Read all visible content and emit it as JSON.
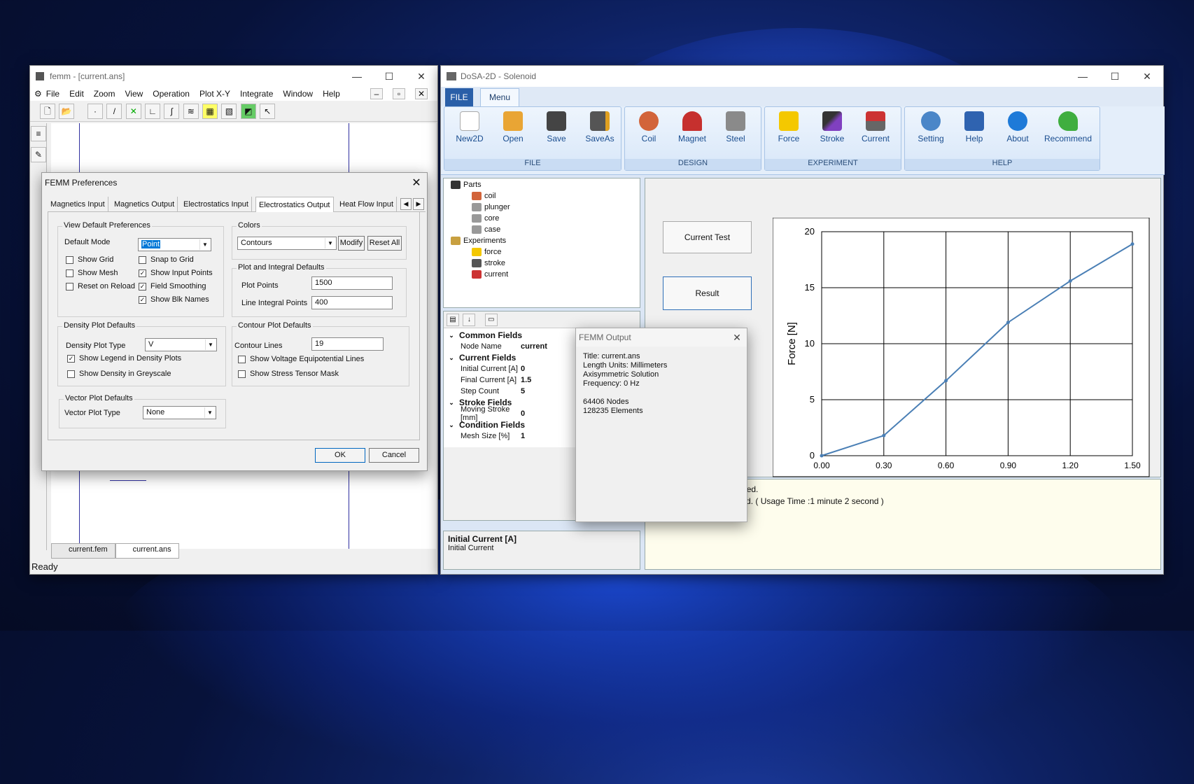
{
  "femm": {
    "title": "femm - [current.ans]",
    "menu": [
      "File",
      "Edit",
      "Zoom",
      "View",
      "Operation",
      "Plot X-Y",
      "Integrate",
      "Window",
      "Help"
    ],
    "status": "Ready",
    "doc_tabs": [
      "current.fem",
      "current.ans"
    ]
  },
  "prefs": {
    "title": "FEMM Preferences",
    "tabs": [
      "Magnetics Input",
      "Magnetics Output",
      "Electrostatics Input",
      "Electrostatics Output",
      "Heat Flow Input"
    ],
    "view_defaults": {
      "label": "View Default Preferences",
      "default_mode_label": "Default Mode",
      "default_mode_value": "Point",
      "show_grid": "Show Grid",
      "snap_grid": "Snap to Grid",
      "show_mesh": "Show Mesh",
      "show_input_points": "Show Input Points",
      "reset_reload": "Reset on Reload",
      "field_smoothing": "Field Smoothing",
      "show_blk_names": "Show Blk Names"
    },
    "colors": {
      "label": "Colors",
      "value": "Contours",
      "modify": "Modify",
      "reset_all": "Reset All"
    },
    "plot_integral": {
      "label": "Plot and Integral Defaults",
      "plot_points_label": "Plot Points",
      "plot_points": "1500",
      "line_points_label": "Line Integral Points",
      "line_points": "400"
    },
    "density": {
      "label": "Density Plot Defaults",
      "type_label": "Density Plot Type",
      "type_value": "V",
      "legend": "Show Legend in Density Plots",
      "greyscale": "Show Density in Greyscale"
    },
    "contour": {
      "label": "Contour Plot Defaults",
      "lines_label": "Contour Lines",
      "lines_value": "19",
      "voltage": "Show Voltage Equipotential Lines",
      "stress": "Show Stress Tensor Mask"
    },
    "vector": {
      "label": "Vector Plot Defaults",
      "type_label": "Vector Plot Type",
      "type_value": "None"
    },
    "ok": "OK",
    "cancel": "Cancel"
  },
  "dosa": {
    "title": "DoSA-2D - Solenoid",
    "tabs": {
      "file": "FILE",
      "menu": "Menu"
    },
    "ribbon": {
      "file": {
        "caption": "FILE",
        "items": [
          "New2D",
          "Open",
          "Save",
          "SaveAs"
        ]
      },
      "design": {
        "caption": "DESIGN",
        "items": [
          "Coil",
          "Magnet",
          "Steel"
        ]
      },
      "experiment": {
        "caption": "EXPERIMENT",
        "items": [
          "Force",
          "Stroke",
          "Current"
        ]
      },
      "help": {
        "caption": "HELP",
        "items": [
          "Setting",
          "Help",
          "About",
          "Recommend"
        ]
      }
    },
    "tree": {
      "parts": "Parts",
      "coil": "coil",
      "plunger": "plunger",
      "core": "core",
      "case": "case",
      "experiments": "Experiments",
      "force": "force",
      "stroke": "stroke",
      "current": "current"
    },
    "props": {
      "common": "Common Fields",
      "node_name_k": "Node Name",
      "node_name_v": "current",
      "current": "Current Fields",
      "init_k": "Initial Current [A]",
      "init_v": "0",
      "final_k": "Final Current [A]",
      "final_v": "1.5",
      "step_k": "Step Count",
      "step_v": "5",
      "stroke": "Stroke Fields",
      "moving_k": "Moving Stroke [mm]",
      "moving_v": "0",
      "condition": "Condition Fields",
      "mesh_k": "Mesh Size [%]",
      "mesh_v": "1"
    },
    "desc": {
      "title": "Initial Current [A]",
      "text": "Initial Current"
    },
    "buttons": {
      "current_test": "Current Test",
      "result": "Result"
    },
    "log": [
      "opened.",
      "pleted. ( Usage Time :1 minute 2 second )"
    ]
  },
  "femm_output": {
    "title": "FEMM Output",
    "lines": [
      "Title: current.ans",
      "Length Units: Millimeters",
      "Axisymmetric Solution",
      "Frequency: 0 Hz",
      "",
      "64406 Nodes",
      "128235 Elements"
    ]
  },
  "chart_data": {
    "type": "line",
    "x": [
      0.0,
      0.3,
      0.6,
      0.9,
      1.2,
      1.5
    ],
    "series": [
      {
        "values": [
          0,
          1.8,
          6.7,
          11.9,
          15.6,
          18.9
        ]
      }
    ],
    "ylabel": "Force [N]",
    "xlabel": "",
    "xlim": [
      0,
      1.5
    ],
    "ylim": [
      0,
      20
    ],
    "xticks": [
      "0.00",
      "0.30",
      "0.60",
      "0.90",
      "1.20",
      "1.50"
    ],
    "yticks": [
      "0",
      "5",
      "10",
      "15",
      "20"
    ],
    "grid": true,
    "colors": {
      "line": "#4a7fb5"
    }
  }
}
